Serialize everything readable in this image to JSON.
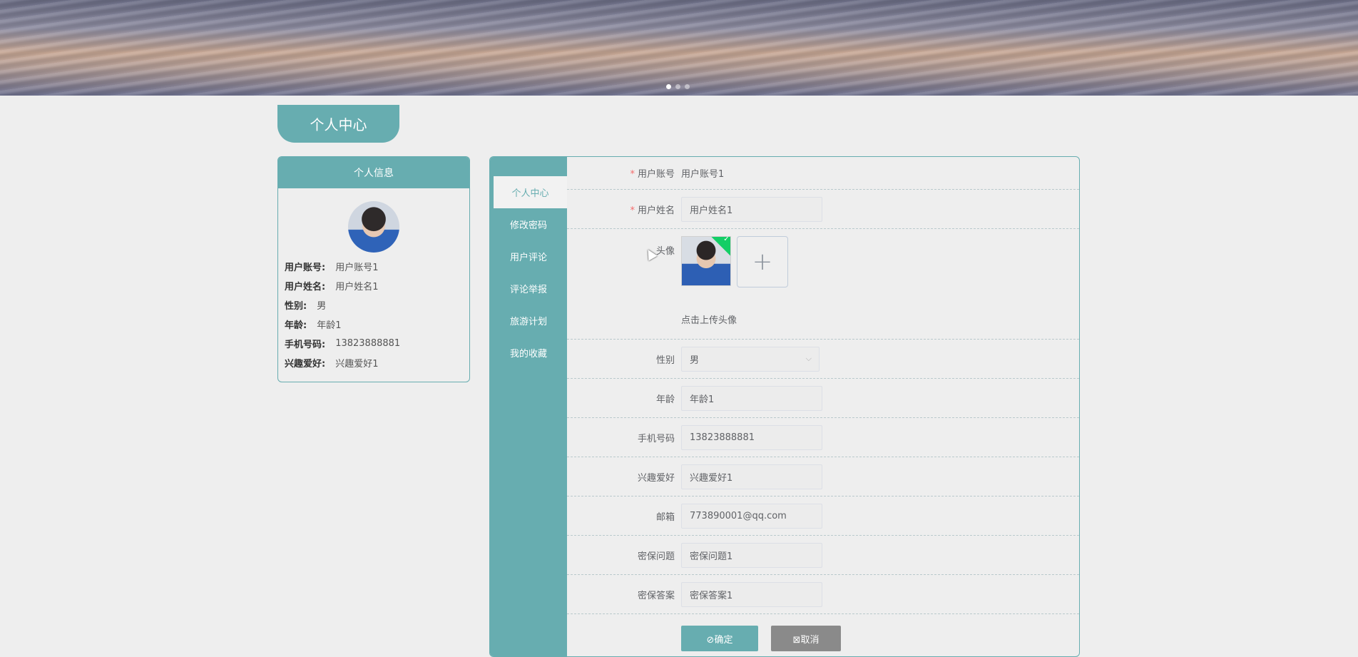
{
  "banner": {
    "carousel_dots": [
      true,
      false,
      false
    ]
  },
  "page_title": "个人中心",
  "info_card": {
    "title": "个人信息",
    "rows": [
      {
        "label": "用户账号:",
        "value": "用户账号1"
      },
      {
        "label": "用户姓名:",
        "value": "用户姓名1"
      },
      {
        "label": "性别:",
        "value": "男"
      },
      {
        "label": "年龄:",
        "value": "年龄1"
      },
      {
        "label": "手机号码:",
        "value": "13823888881"
      },
      {
        "label": "兴趣爱好:",
        "value": "兴趣爱好1"
      }
    ]
  },
  "menu": {
    "items": [
      {
        "label": "个人中心",
        "active": true
      },
      {
        "label": "修改密码",
        "active": false
      },
      {
        "label": "用户评论",
        "active": false
      },
      {
        "label": "评论举报",
        "active": false
      },
      {
        "label": "旅游计划",
        "active": false
      },
      {
        "label": "我的收藏",
        "active": false
      }
    ]
  },
  "form": {
    "account": {
      "label": "用户账号",
      "value": "用户账号1",
      "required": "*"
    },
    "name": {
      "label": "用户姓名",
      "value": "用户姓名1",
      "required": "*"
    },
    "avatar": {
      "label": "头像",
      "upload_plus": "+",
      "tip": "点击上传头像",
      "check": "✓"
    },
    "gender": {
      "label": "性别",
      "value": "男",
      "chevron": "⌵"
    },
    "age": {
      "label": "年龄",
      "value": "年龄1"
    },
    "phone": {
      "label": "手机号码",
      "value": "13823888881"
    },
    "hobby": {
      "label": "兴趣爱好",
      "value": "兴趣爱好1"
    },
    "email": {
      "label": "邮箱",
      "value": "773890001@qq.com"
    },
    "question": {
      "label": "密保问题",
      "value": "密保问题1"
    },
    "answer": {
      "label": "密保答案",
      "value": "密保答案1"
    },
    "buttons": {
      "ok": "⊘确定",
      "cancel": "⊠取消"
    }
  },
  "colors": {
    "accent": "#67adb0",
    "required": "#f56c6c",
    "cancel": "#8a8a8a"
  }
}
